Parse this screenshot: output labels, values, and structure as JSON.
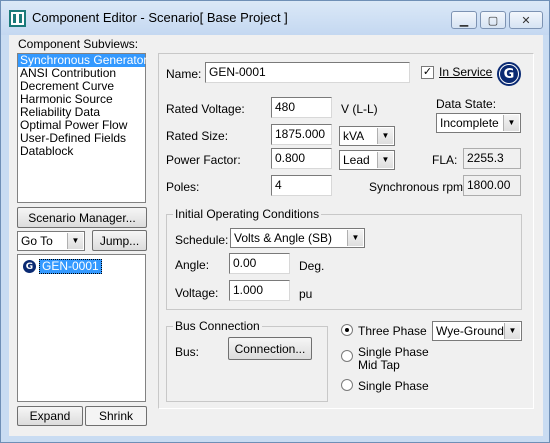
{
  "window": {
    "title": "Component Editor  - Scenario[ Base Project ]"
  },
  "titlebar_buttons": {
    "minimize": "▁",
    "maximize": "▢",
    "close": "✕"
  },
  "left": {
    "subviews_label": "Component Subviews:",
    "subviews": [
      "Synchronous Generator",
      "ANSI Contribution",
      "Decrement Curve",
      "Harmonic Source",
      "Reliability Data",
      "Optimal Power Flow",
      "User-Defined Fields",
      "Datablock"
    ],
    "selected_index": 0,
    "scenario_manager": "Scenario Manager...",
    "goto_value": "Go To",
    "jump": "Jump...",
    "tree_item": "GEN-0001",
    "tree_icon": "G",
    "expand": "Expand",
    "shrink": "Shrink"
  },
  "form": {
    "name_label": "Name:",
    "name_value": "GEN-0001",
    "in_service_label": "In Service",
    "in_service_checked": "✓",
    "gen_icon": "G",
    "rated_voltage_label": "Rated Voltage:",
    "rated_voltage_value": "480",
    "rated_voltage_unit": "V (L-L)",
    "data_state_label": "Data State:",
    "data_state_value": "Incomplete",
    "rated_size_label": "Rated Size:",
    "rated_size_value": "1875.000",
    "rated_size_unit": "kVA",
    "power_factor_label": "Power Factor:",
    "power_factor_value": "0.800",
    "power_factor_mode": "Lead",
    "fla_label": "FLA:",
    "fla_value": "2255.3",
    "poles_label": "Poles:",
    "poles_value": "4",
    "sync_rpm_label": "Synchronous rpm:",
    "sync_rpm_value": "1800.00",
    "ioc_title": "Initial Operating Conditions",
    "schedule_label": "Schedule:",
    "schedule_value": "Volts & Angle (SB)",
    "angle_label": "Angle:",
    "angle_value": "0.00",
    "angle_unit": "Deg.",
    "voltage_label": "Voltage:",
    "voltage_value": "1.000",
    "voltage_unit": "pu",
    "bus_conn_title": "Bus Connection",
    "bus_label": "Bus:",
    "connection_button": "Connection...",
    "phase_options": [
      "Three Phase",
      "Single Phase\nMid Tap",
      "Single Phase"
    ],
    "phase_selected": 0,
    "grounding_value": "Wye-Ground"
  }
}
